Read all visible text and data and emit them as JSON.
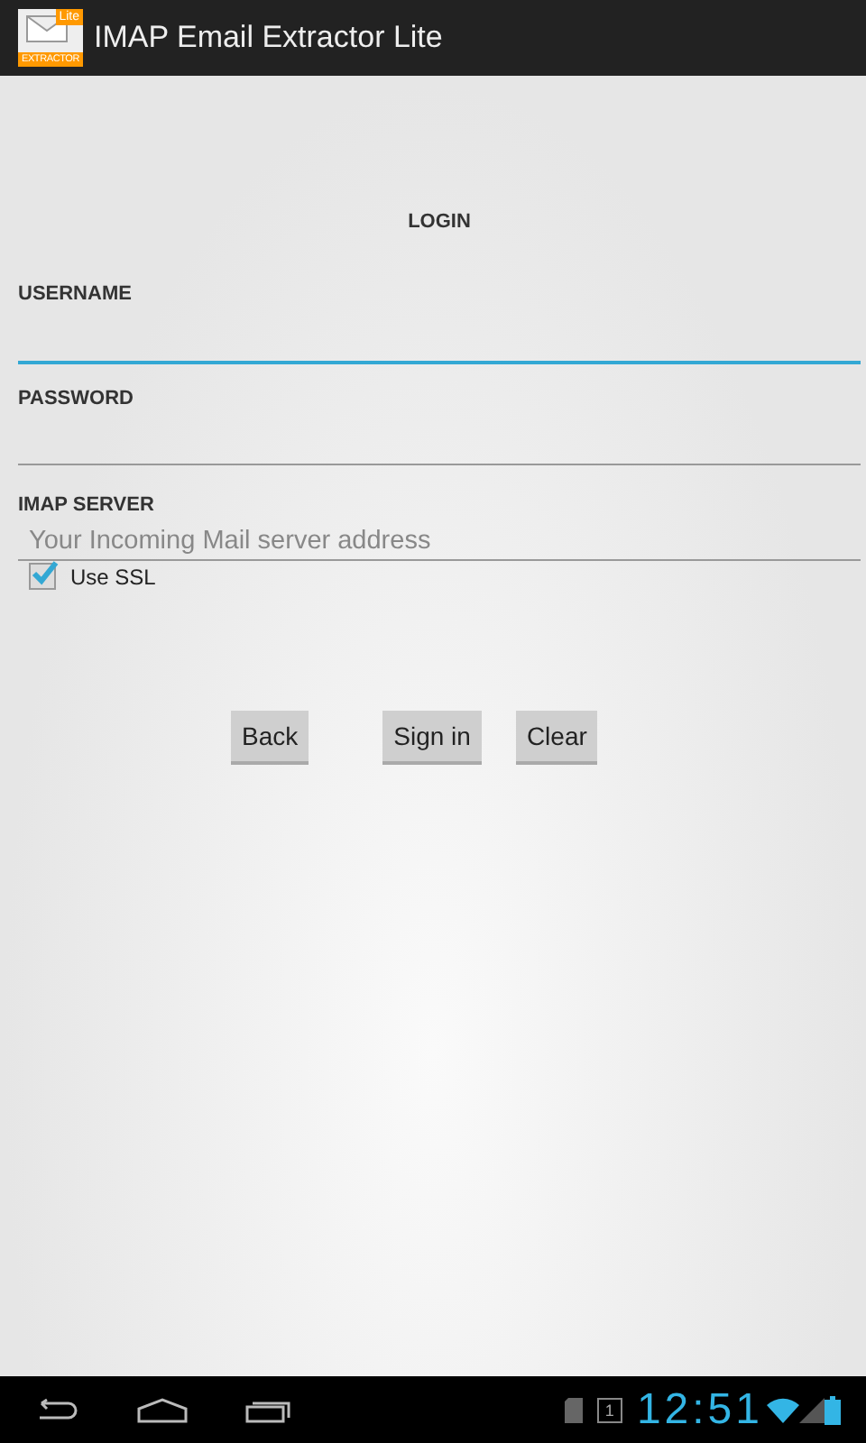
{
  "action_bar": {
    "logo": {
      "badge": "Lite",
      "caption": "EXTRACTOR"
    },
    "title": "IMAP Email Extractor Lite"
  },
  "heading": "LOGIN",
  "fields": [
    {
      "label": "USERNAME",
      "focused": true
    },
    {
      "label": "PASSWORD",
      "focused": false
    },
    {
      "label": "IMAP SERVER",
      "placeholder": "Your Incoming Mail server address",
      "focused": false
    }
  ],
  "checkbox": {
    "label": "Use SSL",
    "checked": true
  },
  "buttons": [
    "Back",
    "Sign in",
    "Clear"
  ],
  "status_bar": {
    "calendar_day": "1",
    "time": "12:51"
  }
}
